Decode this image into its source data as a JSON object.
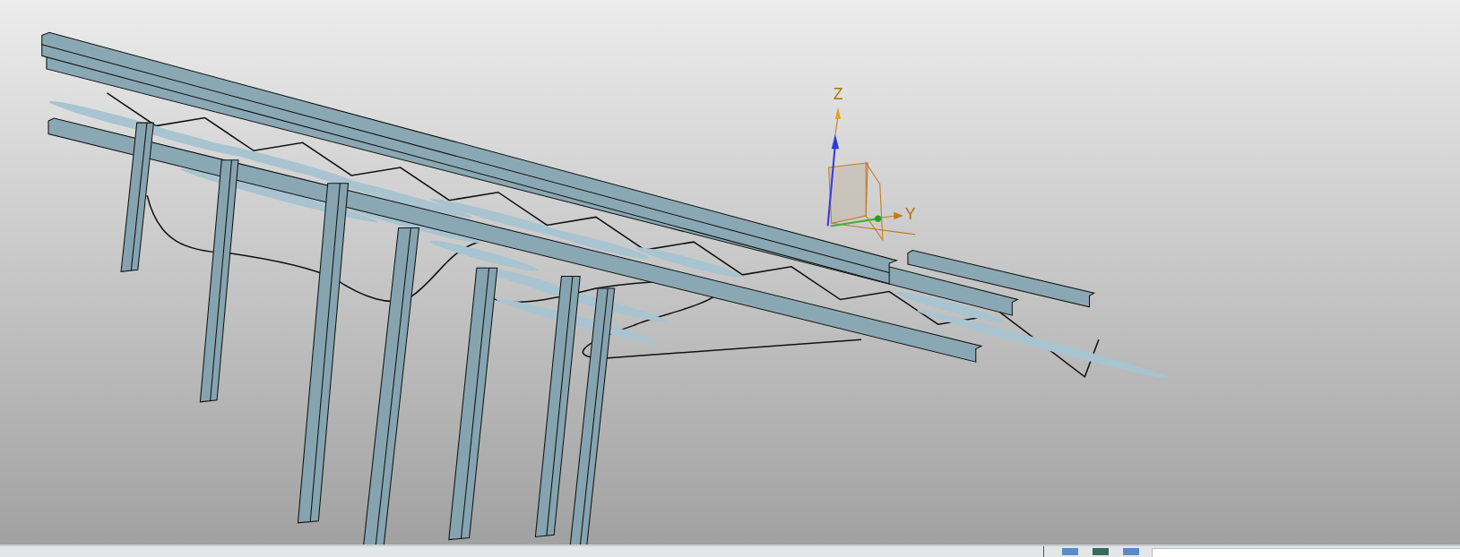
{
  "viewport": {
    "triad": {
      "axes": [
        {
          "kind": "z",
          "label": "Z"
        },
        {
          "kind": "y",
          "label": "Y"
        }
      ]
    }
  }
}
